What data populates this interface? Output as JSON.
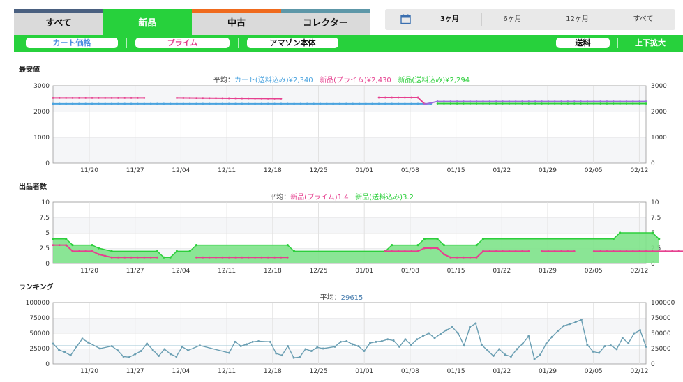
{
  "tabs": [
    {
      "label": "すべて",
      "active": false
    },
    {
      "label": "新品",
      "active": true
    },
    {
      "label": "中古",
      "active": false
    },
    {
      "label": "コレクター",
      "active": false
    }
  ],
  "ranges": [
    {
      "label": "3ヶ月",
      "selected": true
    },
    {
      "label": "6ヶ月",
      "selected": false
    },
    {
      "label": "12ヶ月",
      "selected": false
    },
    {
      "label": "すべて",
      "selected": false
    }
  ],
  "toggles": [
    {
      "label": "カート価格",
      "color": "#4f8fe0"
    },
    {
      "label": "プライム",
      "color": "#e23d8a"
    },
    {
      "label": "アマゾン本体",
      "color": "#111111"
    },
    {
      "label": "送料",
      "color": "#111111"
    }
  ],
  "zoom_label": "上下拡大",
  "colors": {
    "cart": "#4aa3df",
    "prime": "#e6408f",
    "shipping": "#2dcf3c",
    "purple": "#9b6ddb",
    "rank": "#6b9fb3"
  },
  "x_labels": [
    "11/20",
    "11/27",
    "12/04",
    "12/11",
    "12/18",
    "12/25",
    "01/01",
    "01/08",
    "01/15",
    "01/22",
    "01/29",
    "02/05",
    "02/12"
  ],
  "chart_data": [
    {
      "type": "line",
      "title": "最安値",
      "avg": {
        "prefix": "平均：",
        "items": [
          {
            "label": "カート(送料込み)",
            "value": "¥2,340",
            "color": "#4aa3df"
          },
          {
            "label": "新品(プライム)",
            "value": "¥2,430",
            "color": "#e6408f"
          },
          {
            "label": "新品(送料込み)",
            "value": "¥2,294",
            "color": "#2dcf3c"
          }
        ]
      },
      "y_ticks": [
        "0",
        "1000",
        "2000",
        "3000"
      ],
      "ylim": [
        0,
        3000
      ],
      "xlim": [
        0,
        91
      ],
      "series": [
        {
          "name": "カート(送料込み)",
          "color": "#4aa3df",
          "segments": [
            [
              [
                0,
                2300
              ],
              [
                58,
                2300
              ]
            ]
          ]
        },
        {
          "name": "新品(プライム)",
          "color": "#e6408f",
          "segments": [
            [
              [
                0,
                2530
              ],
              [
                14,
                2530
              ]
            ],
            [
              [
                19,
                2530
              ],
              [
                35,
                2500
              ]
            ],
            [
              [
                50,
                2540
              ],
              [
                56,
                2540
              ],
              [
                57,
                2300
              ]
            ]
          ]
        },
        {
          "name": "新品(送料込み)",
          "color": "#2dcf3c",
          "segments": [
            [
              [
                59,
                2310
              ],
              [
                91,
                2310
              ]
            ]
          ]
        },
        {
          "name": "",
          "color": "#9b6ddb",
          "segments": [
            [
              [
                57,
                2280
              ],
              [
                59,
                2390
              ],
              [
                91,
                2390
              ]
            ]
          ]
        }
      ]
    },
    {
      "type": "area",
      "title": "出品者数",
      "avg": {
        "prefix": "平均：",
        "items": [
          {
            "label": "新品(プライム)",
            "value": "1.4",
            "color": "#e6408f"
          },
          {
            "label": "新品(送料込み)",
            "value": "3.2",
            "color": "#2dcf3c"
          }
        ]
      },
      "y_ticks": [
        "0",
        "2.5",
        "5",
        "7.5",
        "10"
      ],
      "ylim": [
        0,
        10
      ],
      "xlim": [
        0,
        91
      ],
      "series": [
        {
          "name": "新品(送料込み)",
          "color": "#2dcf3c",
          "points": [
            [
              0,
              4
            ],
            [
              2,
              4
            ],
            [
              3,
              3
            ],
            [
              6,
              3
            ],
            [
              7,
              2.5
            ],
            [
              9,
              2
            ],
            [
              16,
              2
            ],
            [
              17,
              1
            ],
            [
              18,
              1
            ],
            [
              19,
              2
            ],
            [
              21,
              2
            ],
            [
              22,
              3
            ],
            [
              36,
              3
            ],
            [
              37,
              2
            ],
            [
              51,
              2
            ],
            [
              52,
              3
            ],
            [
              56,
              3
            ],
            [
              57,
              4
            ],
            [
              59,
              4
            ],
            [
              60,
              3
            ],
            [
              65,
              3
            ],
            [
              66,
              4
            ],
            [
              86,
              4
            ],
            [
              87,
              5
            ],
            [
              92,
              5
            ],
            [
              93,
              4
            ]
          ]
        },
        {
          "name": "新品(プライム)",
          "color": "#e6408f",
          "segments": [
            [
              [
                0,
                3
              ],
              [
                2,
                3
              ],
              [
                3,
                2
              ],
              [
                6,
                2
              ],
              [
                7,
                1.5
              ],
              [
                9,
                1
              ],
              [
                16,
                1
              ]
            ],
            [
              [
                22,
                1
              ],
              [
                36,
                1
              ]
            ],
            [
              [
                51,
                2
              ],
              [
                56,
                2
              ],
              [
                57,
                2.5
              ],
              [
                59,
                2.5
              ],
              [
                60,
                1.5
              ],
              [
                61,
                1
              ],
              [
                65,
                1
              ],
              [
                66,
                2
              ],
              [
                73,
                2
              ]
            ],
            [
              [
                75,
                2
              ],
              [
                80,
                2
              ]
            ],
            [
              [
                83,
                2
              ],
              [
                100,
                2
              ]
            ],
            [
              [
                102,
                3
              ],
              [
                107,
                3
              ]
            ],
            [
              [
                110,
                3
              ],
              [
                112,
                2
              ]
            ]
          ]
        }
      ]
    },
    {
      "type": "line",
      "title": "ランキング",
      "avg": {
        "prefix": "平均：",
        "items": [
          {
            "label": "",
            "value": "29615",
            "color": "#4a7fb0"
          }
        ]
      },
      "y_ticks": [
        "0",
        "25000",
        "50000",
        "75000",
        "100000"
      ],
      "ylim": [
        0,
        100000
      ],
      "xlim": [
        0,
        91
      ],
      "average_line": 29615,
      "series": [
        {
          "name": "ランキング",
          "color": "#6b9fb3",
          "points": [
            [
              0,
              33000
            ],
            [
              1,
              23000
            ],
            [
              2,
              19000
            ],
            [
              3,
              14000
            ],
            [
              4,
              28000
            ],
            [
              5,
              41000
            ],
            [
              6,
              35000
            ],
            [
              8,
              25000
            ],
            [
              10,
              29000
            ],
            [
              11,
              22000
            ],
            [
              12,
              12000
            ],
            [
              13,
              11000
            ],
            [
              14,
              16000
            ],
            [
              15,
              21000
            ],
            [
              16,
              33000
            ],
            [
              17,
              23000
            ],
            [
              18,
              13000
            ],
            [
              19,
              24000
            ],
            [
              20,
              16000
            ],
            [
              21,
              12000
            ],
            [
              22,
              28000
            ],
            [
              23,
              22000
            ],
            [
              25,
              30000
            ],
            [
              30,
              18000
            ],
            [
              31,
              36000
            ],
            [
              32,
              29000
            ],
            [
              33,
              32000
            ],
            [
              34,
              36000
            ],
            [
              35,
              37000
            ],
            [
              37,
              36000
            ],
            [
              38,
              17000
            ],
            [
              39,
              14000
            ],
            [
              40,
              29000
            ],
            [
              41,
              10000
            ],
            [
              42,
              11000
            ],
            [
              43,
              24000
            ],
            [
              44,
              21000
            ],
            [
              45,
              27000
            ],
            [
              46,
              25000
            ],
            [
              48,
              28000
            ],
            [
              49,
              36000
            ],
            [
              50,
              37000
            ],
            [
              51,
              32000
            ],
            [
              52,
              29000
            ],
            [
              53,
              21000
            ],
            [
              54,
              34000
            ],
            [
              55,
              36000
            ],
            [
              56,
              37000
            ],
            [
              57,
              40000
            ],
            [
              58,
              38000
            ],
            [
              59,
              28000
            ],
            [
              60,
              40000
            ],
            [
              61,
              31000
            ],
            [
              62,
              40000
            ],
            [
              63,
              45000
            ],
            [
              64,
              50000
            ],
            [
              65,
              42000
            ],
            [
              66,
              49000
            ],
            [
              67,
              55000
            ],
            [
              68,
              60000
            ],
            [
              69,
              50000
            ],
            [
              70,
              30000
            ],
            [
              71,
              60000
            ],
            [
              72,
              66000
            ],
            [
              73,
              31000
            ],
            [
              74,
              22000
            ],
            [
              75,
              13000
            ],
            [
              76,
              24000
            ],
            [
              77,
              15000
            ],
            [
              78,
              12000
            ],
            [
              79,
              24000
            ],
            [
              80,
              33000
            ],
            [
              81,
              45000
            ],
            [
              82,
              8000
            ],
            [
              83,
              15000
            ],
            [
              84,
              33000
            ],
            [
              85,
              44000
            ],
            [
              86,
              54000
            ],
            [
              87,
              62000
            ],
            [
              88,
              65000
            ],
            [
              89,
              68000
            ],
            [
              90,
              72000
            ],
            [
              91,
              31000
            ],
            [
              92,
              20000
            ],
            [
              93,
              18000
            ],
            [
              94,
              29000
            ],
            [
              95,
              30000
            ],
            [
              96,
              24000
            ],
            [
              97,
              42000
            ],
            [
              98,
              34000
            ],
            [
              99,
              50000
            ],
            [
              100,
              55000
            ],
            [
              101,
              28000
            ]
          ]
        }
      ]
    }
  ]
}
